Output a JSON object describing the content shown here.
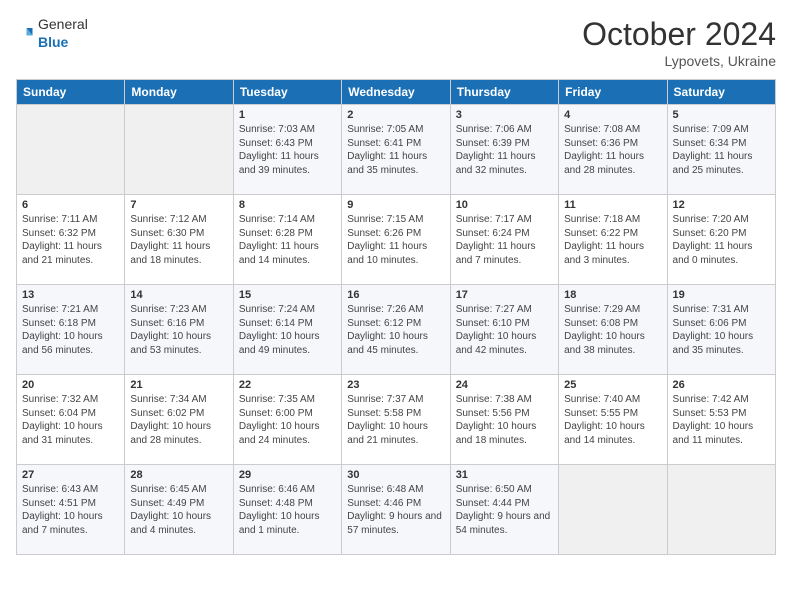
{
  "header": {
    "logo_general": "General",
    "logo_blue": "Blue",
    "month": "October 2024",
    "location": "Lypovets, Ukraine"
  },
  "days_of_week": [
    "Sunday",
    "Monday",
    "Tuesday",
    "Wednesday",
    "Thursday",
    "Friday",
    "Saturday"
  ],
  "weeks": [
    [
      {
        "day": "",
        "info": ""
      },
      {
        "day": "",
        "info": ""
      },
      {
        "day": "1",
        "info": "Sunrise: 7:03 AM\nSunset: 6:43 PM\nDaylight: 11 hours and 39 minutes."
      },
      {
        "day": "2",
        "info": "Sunrise: 7:05 AM\nSunset: 6:41 PM\nDaylight: 11 hours and 35 minutes."
      },
      {
        "day": "3",
        "info": "Sunrise: 7:06 AM\nSunset: 6:39 PM\nDaylight: 11 hours and 32 minutes."
      },
      {
        "day": "4",
        "info": "Sunrise: 7:08 AM\nSunset: 6:36 PM\nDaylight: 11 hours and 28 minutes."
      },
      {
        "day": "5",
        "info": "Sunrise: 7:09 AM\nSunset: 6:34 PM\nDaylight: 11 hours and 25 minutes."
      }
    ],
    [
      {
        "day": "6",
        "info": "Sunrise: 7:11 AM\nSunset: 6:32 PM\nDaylight: 11 hours and 21 minutes."
      },
      {
        "day": "7",
        "info": "Sunrise: 7:12 AM\nSunset: 6:30 PM\nDaylight: 11 hours and 18 minutes."
      },
      {
        "day": "8",
        "info": "Sunrise: 7:14 AM\nSunset: 6:28 PM\nDaylight: 11 hours and 14 minutes."
      },
      {
        "day": "9",
        "info": "Sunrise: 7:15 AM\nSunset: 6:26 PM\nDaylight: 11 hours and 10 minutes."
      },
      {
        "day": "10",
        "info": "Sunrise: 7:17 AM\nSunset: 6:24 PM\nDaylight: 11 hours and 7 minutes."
      },
      {
        "day": "11",
        "info": "Sunrise: 7:18 AM\nSunset: 6:22 PM\nDaylight: 11 hours and 3 minutes."
      },
      {
        "day": "12",
        "info": "Sunrise: 7:20 AM\nSunset: 6:20 PM\nDaylight: 11 hours and 0 minutes."
      }
    ],
    [
      {
        "day": "13",
        "info": "Sunrise: 7:21 AM\nSunset: 6:18 PM\nDaylight: 10 hours and 56 minutes."
      },
      {
        "day": "14",
        "info": "Sunrise: 7:23 AM\nSunset: 6:16 PM\nDaylight: 10 hours and 53 minutes."
      },
      {
        "day": "15",
        "info": "Sunrise: 7:24 AM\nSunset: 6:14 PM\nDaylight: 10 hours and 49 minutes."
      },
      {
        "day": "16",
        "info": "Sunrise: 7:26 AM\nSunset: 6:12 PM\nDaylight: 10 hours and 45 minutes."
      },
      {
        "day": "17",
        "info": "Sunrise: 7:27 AM\nSunset: 6:10 PM\nDaylight: 10 hours and 42 minutes."
      },
      {
        "day": "18",
        "info": "Sunrise: 7:29 AM\nSunset: 6:08 PM\nDaylight: 10 hours and 38 minutes."
      },
      {
        "day": "19",
        "info": "Sunrise: 7:31 AM\nSunset: 6:06 PM\nDaylight: 10 hours and 35 minutes."
      }
    ],
    [
      {
        "day": "20",
        "info": "Sunrise: 7:32 AM\nSunset: 6:04 PM\nDaylight: 10 hours and 31 minutes."
      },
      {
        "day": "21",
        "info": "Sunrise: 7:34 AM\nSunset: 6:02 PM\nDaylight: 10 hours and 28 minutes."
      },
      {
        "day": "22",
        "info": "Sunrise: 7:35 AM\nSunset: 6:00 PM\nDaylight: 10 hours and 24 minutes."
      },
      {
        "day": "23",
        "info": "Sunrise: 7:37 AM\nSunset: 5:58 PM\nDaylight: 10 hours and 21 minutes."
      },
      {
        "day": "24",
        "info": "Sunrise: 7:38 AM\nSunset: 5:56 PM\nDaylight: 10 hours and 18 minutes."
      },
      {
        "day": "25",
        "info": "Sunrise: 7:40 AM\nSunset: 5:55 PM\nDaylight: 10 hours and 14 minutes."
      },
      {
        "day": "26",
        "info": "Sunrise: 7:42 AM\nSunset: 5:53 PM\nDaylight: 10 hours and 11 minutes."
      }
    ],
    [
      {
        "day": "27",
        "info": "Sunrise: 6:43 AM\nSunset: 4:51 PM\nDaylight: 10 hours and 7 minutes."
      },
      {
        "day": "28",
        "info": "Sunrise: 6:45 AM\nSunset: 4:49 PM\nDaylight: 10 hours and 4 minutes."
      },
      {
        "day": "29",
        "info": "Sunrise: 6:46 AM\nSunset: 4:48 PM\nDaylight: 10 hours and 1 minute."
      },
      {
        "day": "30",
        "info": "Sunrise: 6:48 AM\nSunset: 4:46 PM\nDaylight: 9 hours and 57 minutes."
      },
      {
        "day": "31",
        "info": "Sunrise: 6:50 AM\nSunset: 4:44 PM\nDaylight: 9 hours and 54 minutes."
      },
      {
        "day": "",
        "info": ""
      },
      {
        "day": "",
        "info": ""
      }
    ]
  ]
}
